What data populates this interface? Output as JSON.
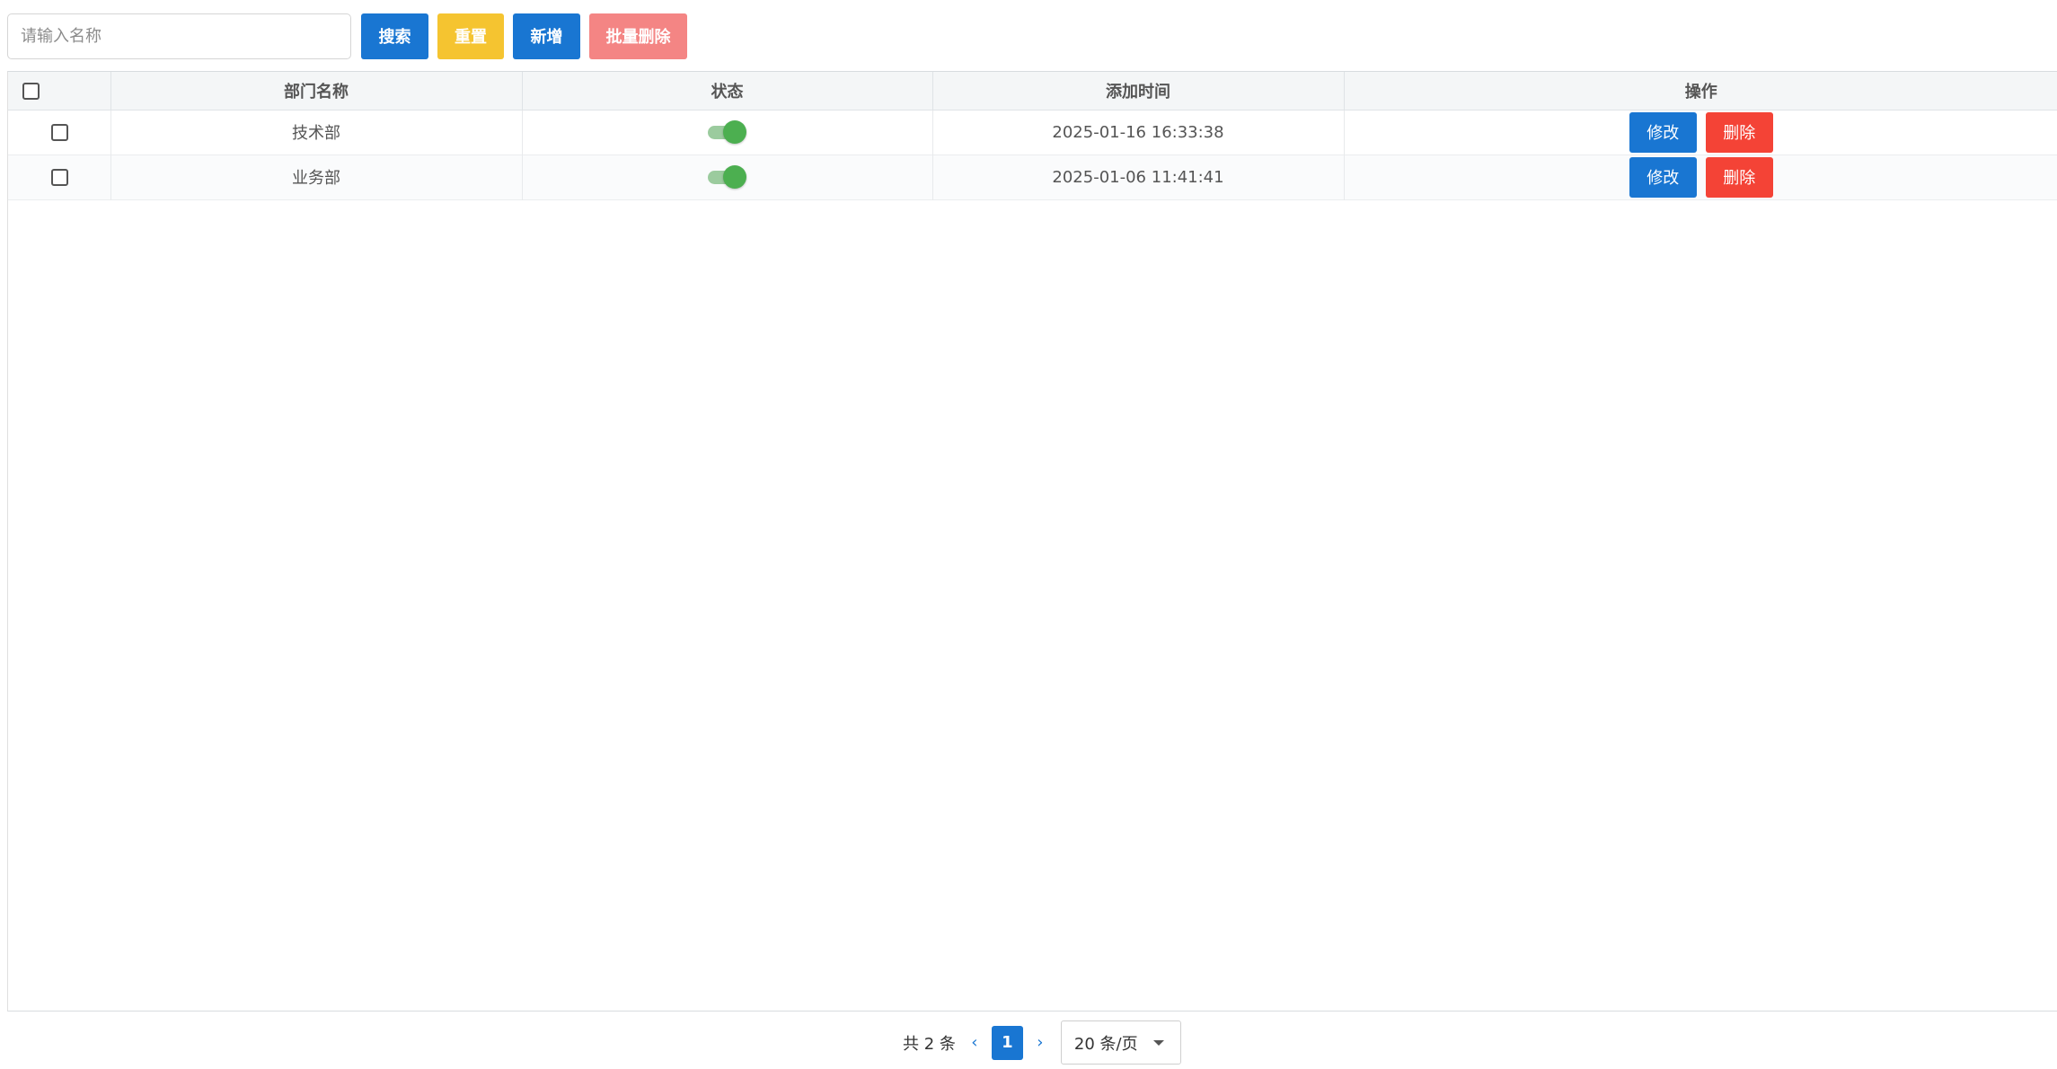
{
  "toolbar": {
    "search_placeholder": "请输入名称",
    "search_label": "搜索",
    "reset_label": "重置",
    "add_label": "新增",
    "batch_delete_label": "批量删除"
  },
  "table": {
    "headers": {
      "name": "部门名称",
      "status": "状态",
      "time": "添加时间",
      "ops": "操作"
    },
    "rows": [
      {
        "name": "技术部",
        "status_on": true,
        "time": "2025-01-16 16:33:38",
        "edit": "修改",
        "delete": "删除"
      },
      {
        "name": "业务部",
        "status_on": true,
        "time": "2025-01-06 11:41:41",
        "edit": "修改",
        "delete": "删除"
      }
    ]
  },
  "pagination": {
    "total": "共 2 条",
    "current_page": "1",
    "page_size": "20 条/页"
  },
  "colors": {
    "primary": "#1976d2",
    "warning": "#f5c430",
    "danger": "#f44336",
    "danger_light": "#f48584",
    "toggle_on": "#4caf50"
  }
}
